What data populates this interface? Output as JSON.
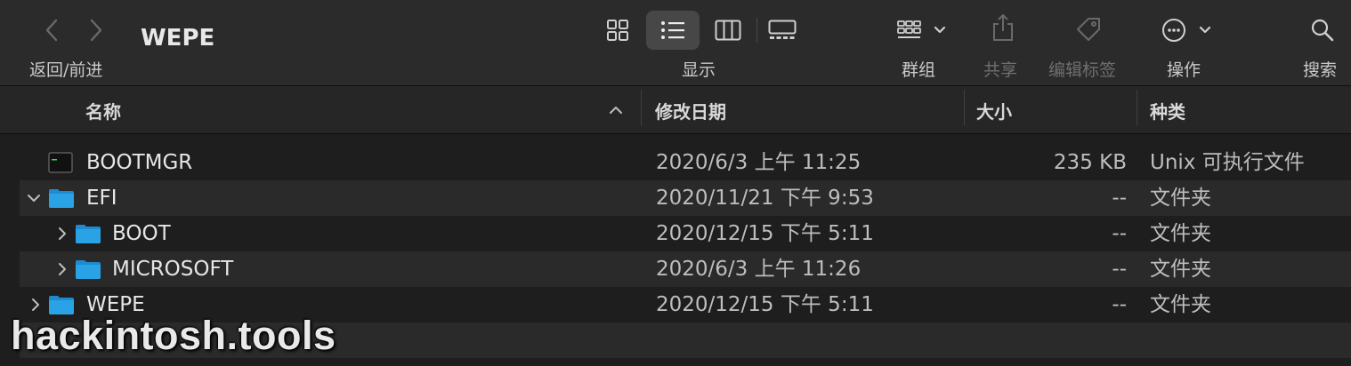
{
  "window": {
    "title": "WEPE"
  },
  "toolbar": {
    "nav_label": "返回/前进",
    "view_label": "显示",
    "group_label": "群组",
    "share_label": "共享",
    "tags_label": "编辑标签",
    "action_label": "操作",
    "search_label": "搜索",
    "selected_view": "list"
  },
  "columns": {
    "name": "名称",
    "modified": "修改日期",
    "size": "大小",
    "kind": "种类"
  },
  "files": [
    {
      "name": "BOOTMGR",
      "date": "2020/6/3 上午 11:25",
      "size": "235 KB",
      "kind": "Unix 可执行文件",
      "icon": "executable-icon",
      "disclosure": ""
    },
    {
      "name": "EFI",
      "date": "2020/11/21 下午 9:53",
      "size": "--",
      "kind": "文件夹",
      "icon": "folder-icon",
      "disclosure": "expanded"
    },
    {
      "name": "BOOT",
      "date": "2020/12/15 下午 5:11",
      "size": "--",
      "kind": "文件夹",
      "icon": "folder-icon",
      "disclosure": "collapsed"
    },
    {
      "name": "MICROSOFT",
      "date": "2020/6/3 上午 11:26",
      "size": "--",
      "kind": "文件夹",
      "icon": "folder-icon",
      "disclosure": "collapsed"
    },
    {
      "name": "WEPE",
      "date": "2020/12/15 下午 5:11",
      "size": "--",
      "kind": "文件夹",
      "icon": "folder-icon",
      "disclosure": "collapsed"
    }
  ],
  "watermark": "hackintosh.tools",
  "colors": {
    "folder": "#2aa3e6",
    "background": "#1e1e1e",
    "toolbar": "#2b2b2b",
    "stripe": "#2a2a2a"
  }
}
